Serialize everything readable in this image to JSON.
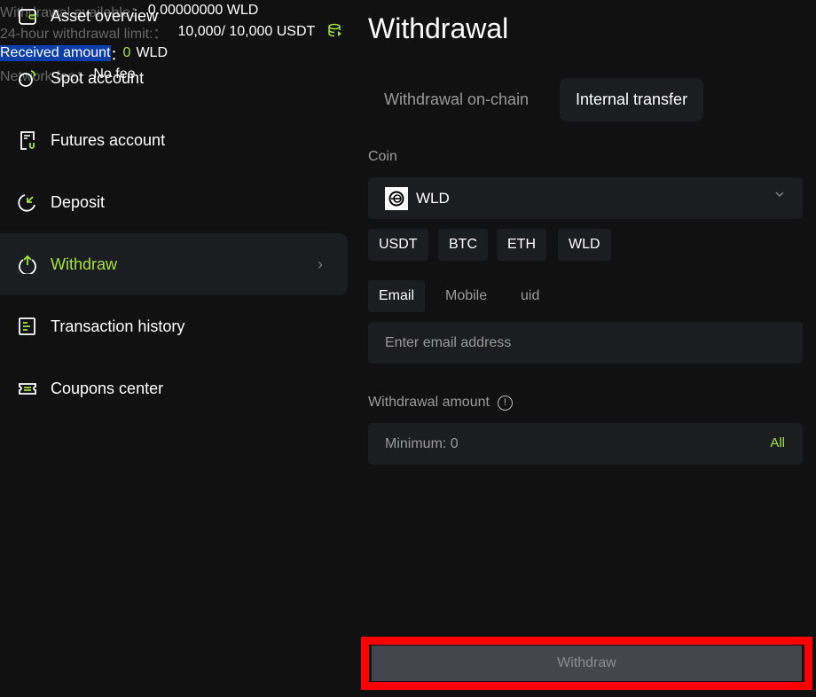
{
  "sidebar": {
    "items": [
      {
        "label": "Asset overview",
        "icon": "wallet-icon"
      },
      {
        "label": "Spot account",
        "icon": "spot-icon"
      },
      {
        "label": "Futures account",
        "icon": "futures-icon"
      },
      {
        "label": "Deposit",
        "icon": "deposit-icon"
      },
      {
        "label": "Withdraw",
        "icon": "withdraw-icon",
        "active": true
      },
      {
        "label": "Transaction history",
        "icon": "history-icon"
      },
      {
        "label": "Coupons center",
        "icon": "coupon-icon"
      }
    ]
  },
  "main": {
    "title": "Withdrawal",
    "tabs": [
      {
        "label": "Withdrawal on-chain"
      },
      {
        "label": "Internal transfer",
        "active": true
      }
    ],
    "coin_label": "Coin",
    "coin_selected": "WLD",
    "quick_coins": [
      "USDT",
      "BTC",
      "ETH",
      "WLD"
    ],
    "recipient_tabs": [
      "Email",
      "Mobile",
      "uid"
    ],
    "email_placeholder": "Enter email address",
    "amount_label": "Withdrawal amount",
    "amount_placeholder": "Minimum: 0",
    "all_label": "All",
    "available_label": "Withdrawal available：",
    "available_value": "0.00000000 WLD",
    "limit_label": "24-hour withdrawal limit:：",
    "limit_value": "10,000/ 10,000 USDT",
    "received_label": "Received amount",
    "received_sep": "：",
    "received_value": "0",
    "received_unit": "WLD",
    "fee_label": "Network fee：",
    "fee_value": "No fee",
    "withdraw_button": "Withdraw"
  },
  "colors": {
    "accent": "#a4e43a",
    "highlight": "#0a3ea8",
    "alert_border": "#ff0000"
  }
}
